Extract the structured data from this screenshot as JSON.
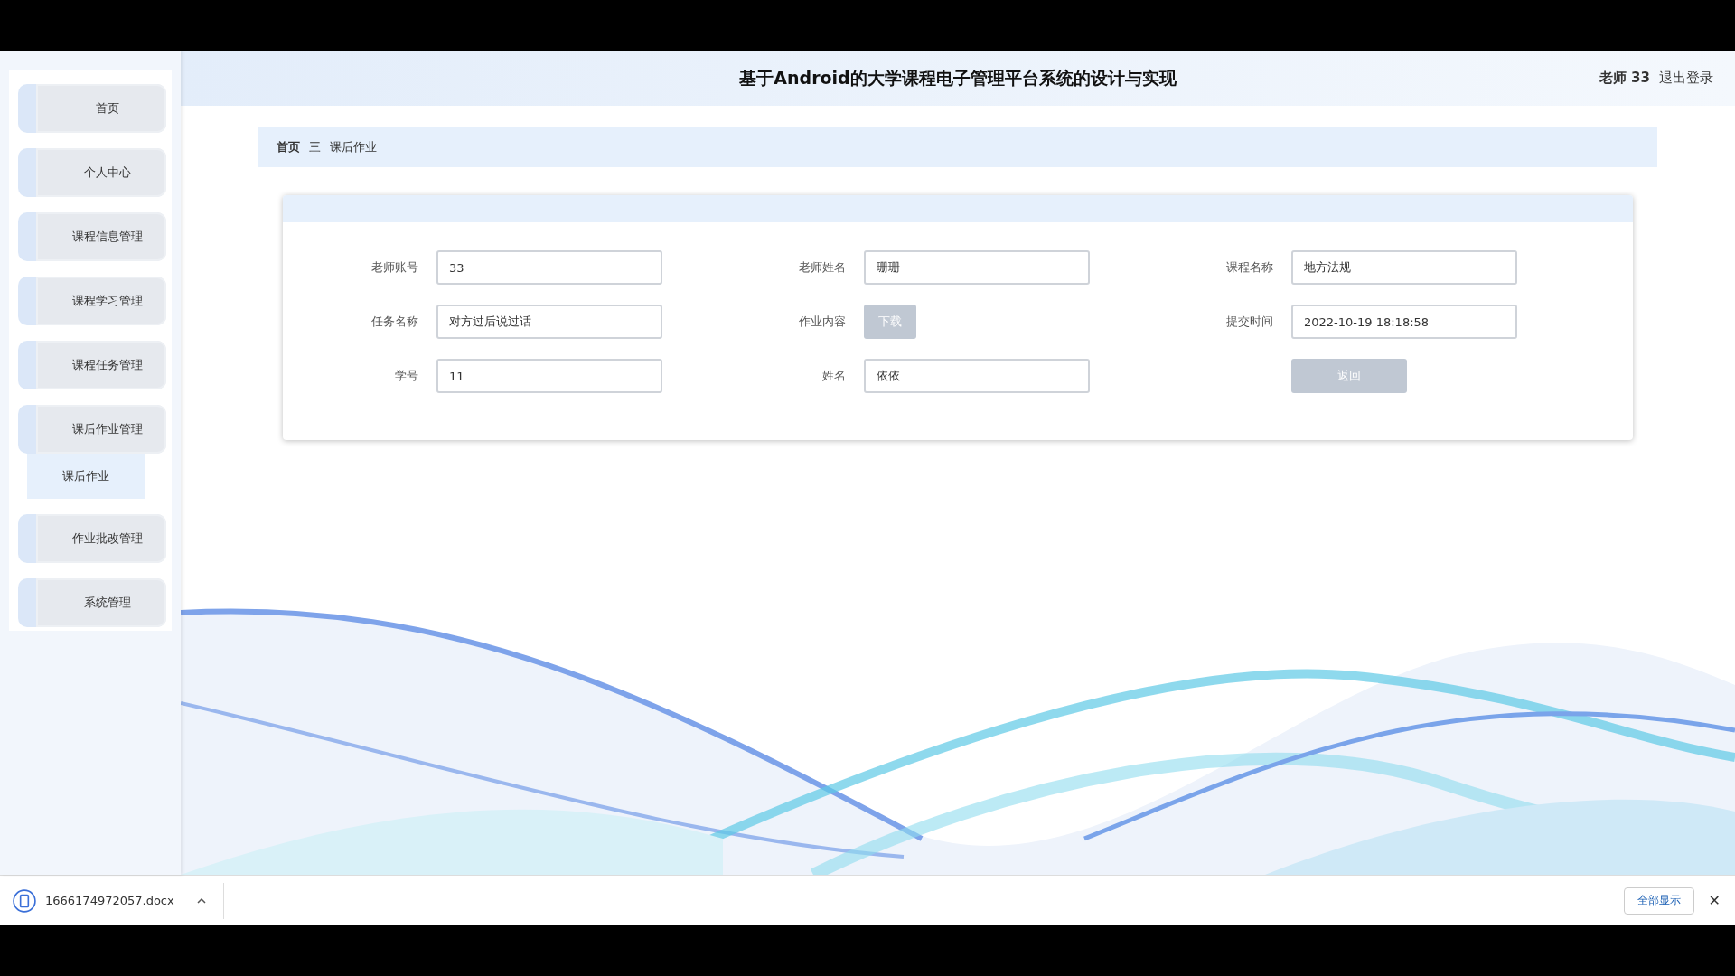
{
  "header": {
    "title": "基于Android的大学课程电子管理平台系统的设计与实现",
    "user": "老师 33",
    "logout": "退出登录"
  },
  "sidebar": {
    "items": [
      {
        "label": "首页"
      },
      {
        "label": "个人中心"
      },
      {
        "label": "课程信息管理"
      },
      {
        "label": "课程学习管理"
      },
      {
        "label": "课程任务管理"
      },
      {
        "label": "课后作业管理",
        "children": [
          {
            "label": "课后作业",
            "selected": true
          }
        ]
      },
      {
        "label": "作业批改管理"
      },
      {
        "label": "系统管理"
      }
    ]
  },
  "breadcrumb": {
    "home": "首页",
    "separator": "三",
    "current": "课后作业"
  },
  "form": {
    "fields": [
      {
        "kind": "input",
        "label": "老师账号",
        "value": "33"
      },
      {
        "kind": "input",
        "label": "老师姓名",
        "value": "珊珊"
      },
      {
        "kind": "input",
        "label": "课程名称",
        "value": "地方法规"
      },
      {
        "kind": "input",
        "label": "任务名称",
        "value": "对方过后说过话"
      },
      {
        "kind": "download",
        "label": "作业内容",
        "value": "下载"
      },
      {
        "kind": "input",
        "label": "提交时间",
        "value": "2022-10-19 18:18:58"
      },
      {
        "kind": "input",
        "label": "学号",
        "value": "11"
      },
      {
        "kind": "input",
        "label": "姓名",
        "value": "依依"
      },
      {
        "kind": "back",
        "value": "返回"
      }
    ]
  },
  "download_bar": {
    "file": "1666174972057.docx",
    "show_all": "全部显示",
    "close": "✕"
  }
}
